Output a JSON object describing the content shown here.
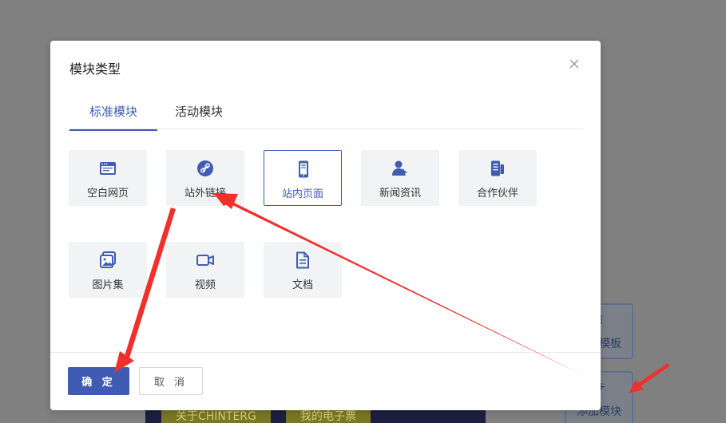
{
  "background": {
    "side_buttons": [
      {
        "label": "添加模板",
        "icon": "doc-icon"
      },
      {
        "label": "添加模块",
        "icon": "plus-icon"
      }
    ],
    "footer_links": [
      "关于CHINTERG",
      "我的电子票"
    ]
  },
  "modal": {
    "title": "模块类型",
    "tabs": [
      {
        "label": "标准模块",
        "active": true
      },
      {
        "label": "活动模块",
        "active": false
      }
    ],
    "tiles": [
      {
        "label": "空白网页",
        "icon": "blank-page-icon",
        "selected": false
      },
      {
        "label": "站外链接",
        "icon": "link-icon",
        "selected": false
      },
      {
        "label": "站内页面",
        "icon": "mobile-page-icon",
        "selected": true
      },
      {
        "label": "新闻资讯",
        "icon": "news-icon",
        "selected": false
      },
      {
        "label": "合作伙伴",
        "icon": "partner-icon",
        "selected": false
      },
      {
        "label": "图片集",
        "icon": "gallery-icon",
        "selected": false
      },
      {
        "label": "视频",
        "icon": "video-icon",
        "selected": false
      },
      {
        "label": "文档",
        "icon": "document-icon",
        "selected": false
      }
    ],
    "confirm_label": "确 定",
    "cancel_label": "取 消"
  },
  "colors": {
    "accent": "#3f5bb3",
    "overlay": "#808080",
    "annotation_arrow": "#f0302c"
  }
}
